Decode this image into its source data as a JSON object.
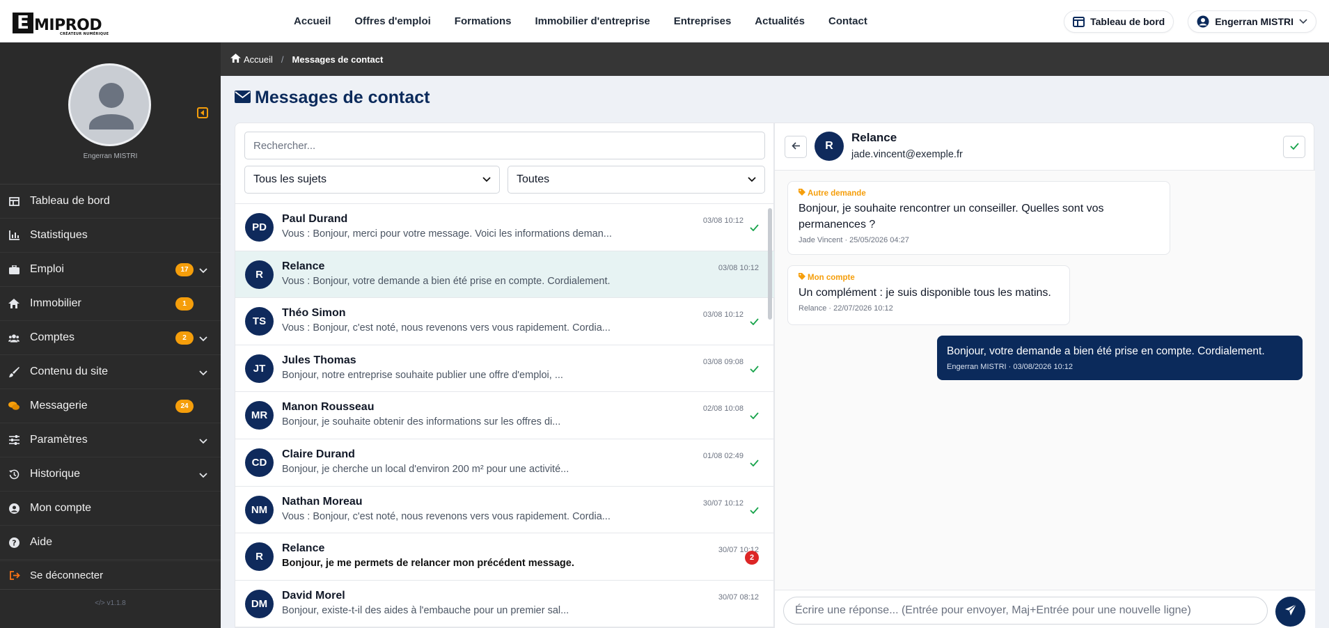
{
  "brand": {
    "logo_e": "E",
    "logo_rest": "MIPROD",
    "tagline": "CRÉATEUR NUMÉRIQUE"
  },
  "nav": {
    "items": [
      "Accueil",
      "Offres d'emploi",
      "Formations",
      "Immobilier d'entreprise",
      "Entreprises",
      "Actualités",
      "Contact"
    ],
    "dashboard_label": "Tableau de bord",
    "user_label": "Engerran MISTRI"
  },
  "sidebar": {
    "user_name": "Engerran MISTRI",
    "items": [
      {
        "label": "Tableau de bord",
        "icon": "dashboard-icon"
      },
      {
        "label": "Statistiques",
        "icon": "chart-icon"
      },
      {
        "label": "Emploi",
        "icon": "briefcase-icon",
        "badge": "17",
        "has_chevron": true
      },
      {
        "label": "Immobilier",
        "icon": "home-icon",
        "badge": "1"
      },
      {
        "label": "Comptes",
        "icon": "users-icon",
        "badge": "2",
        "has_chevron": true
      },
      {
        "label": "Contenu du site",
        "icon": "brush-icon",
        "has_chevron": true
      },
      {
        "label": "Messagerie",
        "icon": "chat-icon",
        "badge": "24"
      },
      {
        "label": "Paramètres",
        "icon": "sliders-icon",
        "has_chevron": true
      },
      {
        "label": "Historique",
        "icon": "history-icon",
        "has_chevron": true
      },
      {
        "label": "Mon compte",
        "icon": "user-circle-icon"
      },
      {
        "label": "Aide",
        "icon": "help-icon"
      }
    ],
    "logout_label": "Se déconnecter",
    "version": "v1.1.8"
  },
  "breadcrumb": {
    "home": "Accueil",
    "separator": "/",
    "current": "Messages de contact"
  },
  "page": {
    "title": "Messages de contact"
  },
  "filters": {
    "search_placeholder": "Rechercher...",
    "subject_selected": "Tous les sujets",
    "status_selected": "Toutes"
  },
  "messages": [
    {
      "initials": "PD",
      "name": "Paul Durand",
      "preview": "Vous : Bonjour, merci pour votre message. Voici les informations deman...",
      "time": "03/08 10:12",
      "status": "read"
    },
    {
      "initials": "R",
      "name": "Relance",
      "preview": "Vous : Bonjour, votre demande a bien été prise en compte. Cordialement.",
      "time": "03/08 10:12",
      "status": "active"
    },
    {
      "initials": "TS",
      "name": "Théo Simon",
      "preview": "Vous : Bonjour, c'est noté, nous revenons vers vous rapidement. Cordia...",
      "time": "03/08 10:12",
      "status": "read"
    },
    {
      "initials": "JT",
      "name": "Jules Thomas",
      "preview": "Bonjour, notre entreprise souhaite publier une offre d'emploi, ...",
      "time": "03/08 09:08",
      "status": "read"
    },
    {
      "initials": "MR",
      "name": "Manon Rousseau",
      "preview": "Bonjour, je souhaite obtenir des informations sur les offres di...",
      "time": "02/08 10:08",
      "status": "read"
    },
    {
      "initials": "CD",
      "name": "Claire Durand",
      "preview": "Bonjour, je cherche un local d'environ 200 m² pour une activité...",
      "time": "01/08 02:49",
      "status": "read"
    },
    {
      "initials": "NM",
      "name": "Nathan Moreau",
      "preview": "Vous : Bonjour, c'est noté, nous revenons vers vous rapidement. Cordia...",
      "time": "30/07 10:12",
      "status": "read"
    },
    {
      "initials": "R",
      "name": "Relance",
      "preview": "Bonjour, je me permets de relancer mon précédent message.",
      "time": "30/07 10:12",
      "status": "unread",
      "unread_count": "2"
    },
    {
      "initials": "DM",
      "name": "David Morel",
      "preview": "Bonjour, existe-t-il des aides à l'embauche pour un premier sal...",
      "time": "30/07 08:12",
      "status": "none"
    }
  ],
  "conversation": {
    "initials": "R",
    "name": "Relance",
    "email": "jade.vincent@exemple.fr",
    "messages": [
      {
        "direction": "in",
        "tag": "Autre demande",
        "text": "Bonjour, je souhaite rencontrer un conseiller. Quelles sont vos permanences ?",
        "meta": "Jade Vincent · 25/05/2026 04:27"
      },
      {
        "direction": "in",
        "tag": "Mon compte",
        "text": "Un complément : je suis disponible tous les matins.",
        "meta": "Relance · 22/07/2026 10:12"
      },
      {
        "direction": "out",
        "text": "Bonjour, votre demande a bien été prise en compte. Cordialement.",
        "meta": "Engerran MISTRI · 03/08/2026 10:12"
      }
    ],
    "reply_placeholder": "Écrire une réponse... (Entrée pour envoyer, Maj+Entrée pour une nouvelle ligne)"
  },
  "colors": {
    "navy": "#0b2a5b",
    "accent": "#f59e0b",
    "sidebar": "#2a2a2a",
    "success": "#16a34a",
    "danger": "#dc2626"
  }
}
